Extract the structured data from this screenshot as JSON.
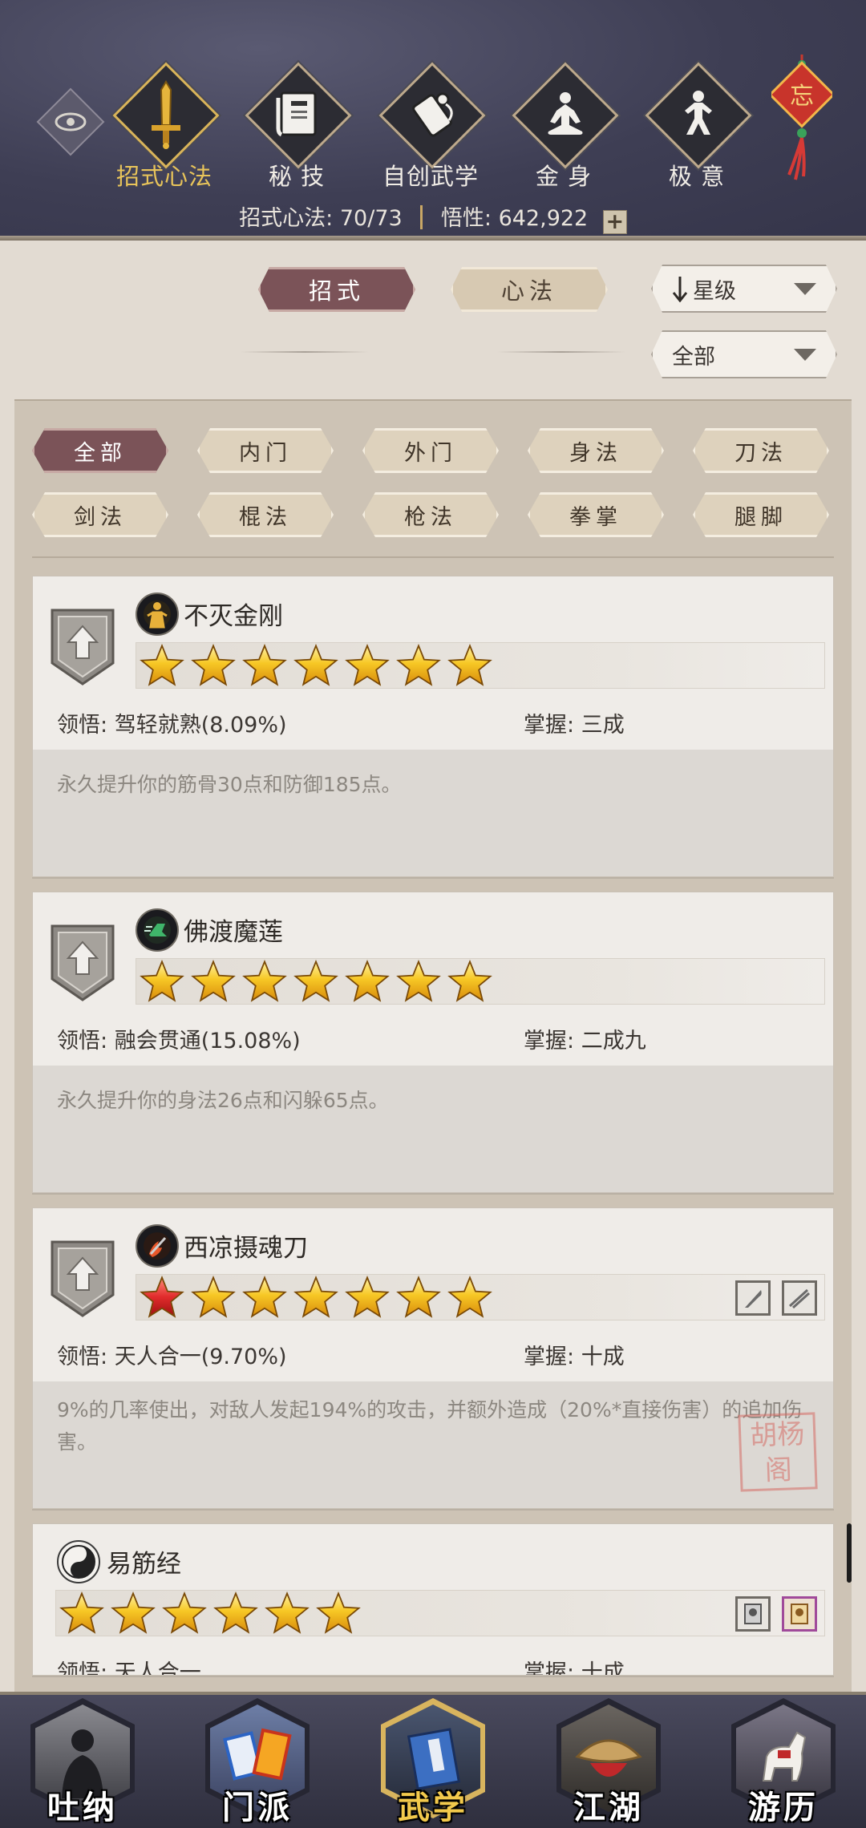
{
  "header": {
    "categories": [
      {
        "label": "招式心法",
        "icon": "sword-icon",
        "active": true
      },
      {
        "label": "秘 技",
        "icon": "book-icon",
        "active": false
      },
      {
        "label": "自创武学",
        "icon": "scroll-icon",
        "active": false
      },
      {
        "label": "金 身",
        "icon": "meditation-icon",
        "active": false
      },
      {
        "label": "极 意",
        "icon": "martial-stance-icon",
        "active": false
      }
    ],
    "ornament_char": "忘",
    "stats": {
      "skills_label": "招式心法:",
      "skills_value": "70/73",
      "insight_label": "悟性:",
      "insight_value": "642,922"
    }
  },
  "tabs": [
    {
      "label": "招式",
      "active": true
    },
    {
      "label": "心法",
      "active": false
    }
  ],
  "sort_dropdown": {
    "value": "星级"
  },
  "filter_dropdown": {
    "value": "全部"
  },
  "filters": [
    {
      "label": "全部",
      "active": true
    },
    {
      "label": "内门",
      "active": false
    },
    {
      "label": "外门",
      "active": false
    },
    {
      "label": "身法",
      "active": false
    },
    {
      "label": "刀法",
      "active": false
    },
    {
      "label": "剑法",
      "active": false
    },
    {
      "label": "棍法",
      "active": false
    },
    {
      "label": "枪法",
      "active": false
    },
    {
      "label": "拳掌",
      "active": false
    },
    {
      "label": "腿脚",
      "active": false
    }
  ],
  "skills": [
    {
      "name": "不灭金刚",
      "icon": "golden-figure-icon",
      "stars": 7,
      "red_stars": 0,
      "insight_label": "领悟:",
      "insight_value": "驾轻就熟(8.09%)",
      "mastery_label": "掌握:",
      "mastery_value": "三成",
      "description": "永久提升你的筋骨30点和防御185点。"
    },
    {
      "name": "佛渡魔莲",
      "icon": "green-boot-icon",
      "stars": 7,
      "red_stars": 0,
      "insight_label": "领悟:",
      "insight_value": "融会贯通(15.08%)",
      "mastery_label": "掌握:",
      "mastery_value": "二成九",
      "description": "永久提升你的身法26点和闪躲65点。"
    },
    {
      "name": "西凉摄魂刀",
      "icon": "flame-blade-icon",
      "stars": 6,
      "red_stars": 1,
      "insight_label": "领悟:",
      "insight_value": "天人合一(9.70%)",
      "mastery_label": "掌握:",
      "mastery_value": "十成",
      "description": "9%的几率使出，对敌人发起194%的攻击，并额外造成（20%*直接伤害）的追加伤害。",
      "weapons": [
        "saber-icon",
        "broken-blade-icon"
      ]
    },
    {
      "name": "易筋经",
      "icon": "yin-yang-icon",
      "stars": 6,
      "red_stars": 0,
      "insight_label": "领悟:",
      "insight_value": "天人合一",
      "mastery_label": "掌握:",
      "mastery_value": "十成",
      "weapons": [
        "silver-token-icon",
        "gold-token-icon"
      ]
    }
  ],
  "watermark": "胡杨阁",
  "bottom_nav": [
    {
      "label": "吐纳",
      "icon": "monk-portrait-icon",
      "active": false
    },
    {
      "label": "门派",
      "icon": "sect-banners-icon",
      "active": false
    },
    {
      "label": "武学",
      "icon": "martial-manual-icon",
      "active": true
    },
    {
      "label": "江湖",
      "icon": "straw-hat-icon",
      "active": false
    },
    {
      "label": "游历",
      "icon": "white-horse-icon",
      "active": false
    }
  ],
  "colors": {
    "header_bg": "#3e3e54",
    "active_tab": "#7b5358",
    "gold_accent": "#e8c45a",
    "star_gold": "#f5c21c",
    "star_red": "#d82a2a"
  }
}
